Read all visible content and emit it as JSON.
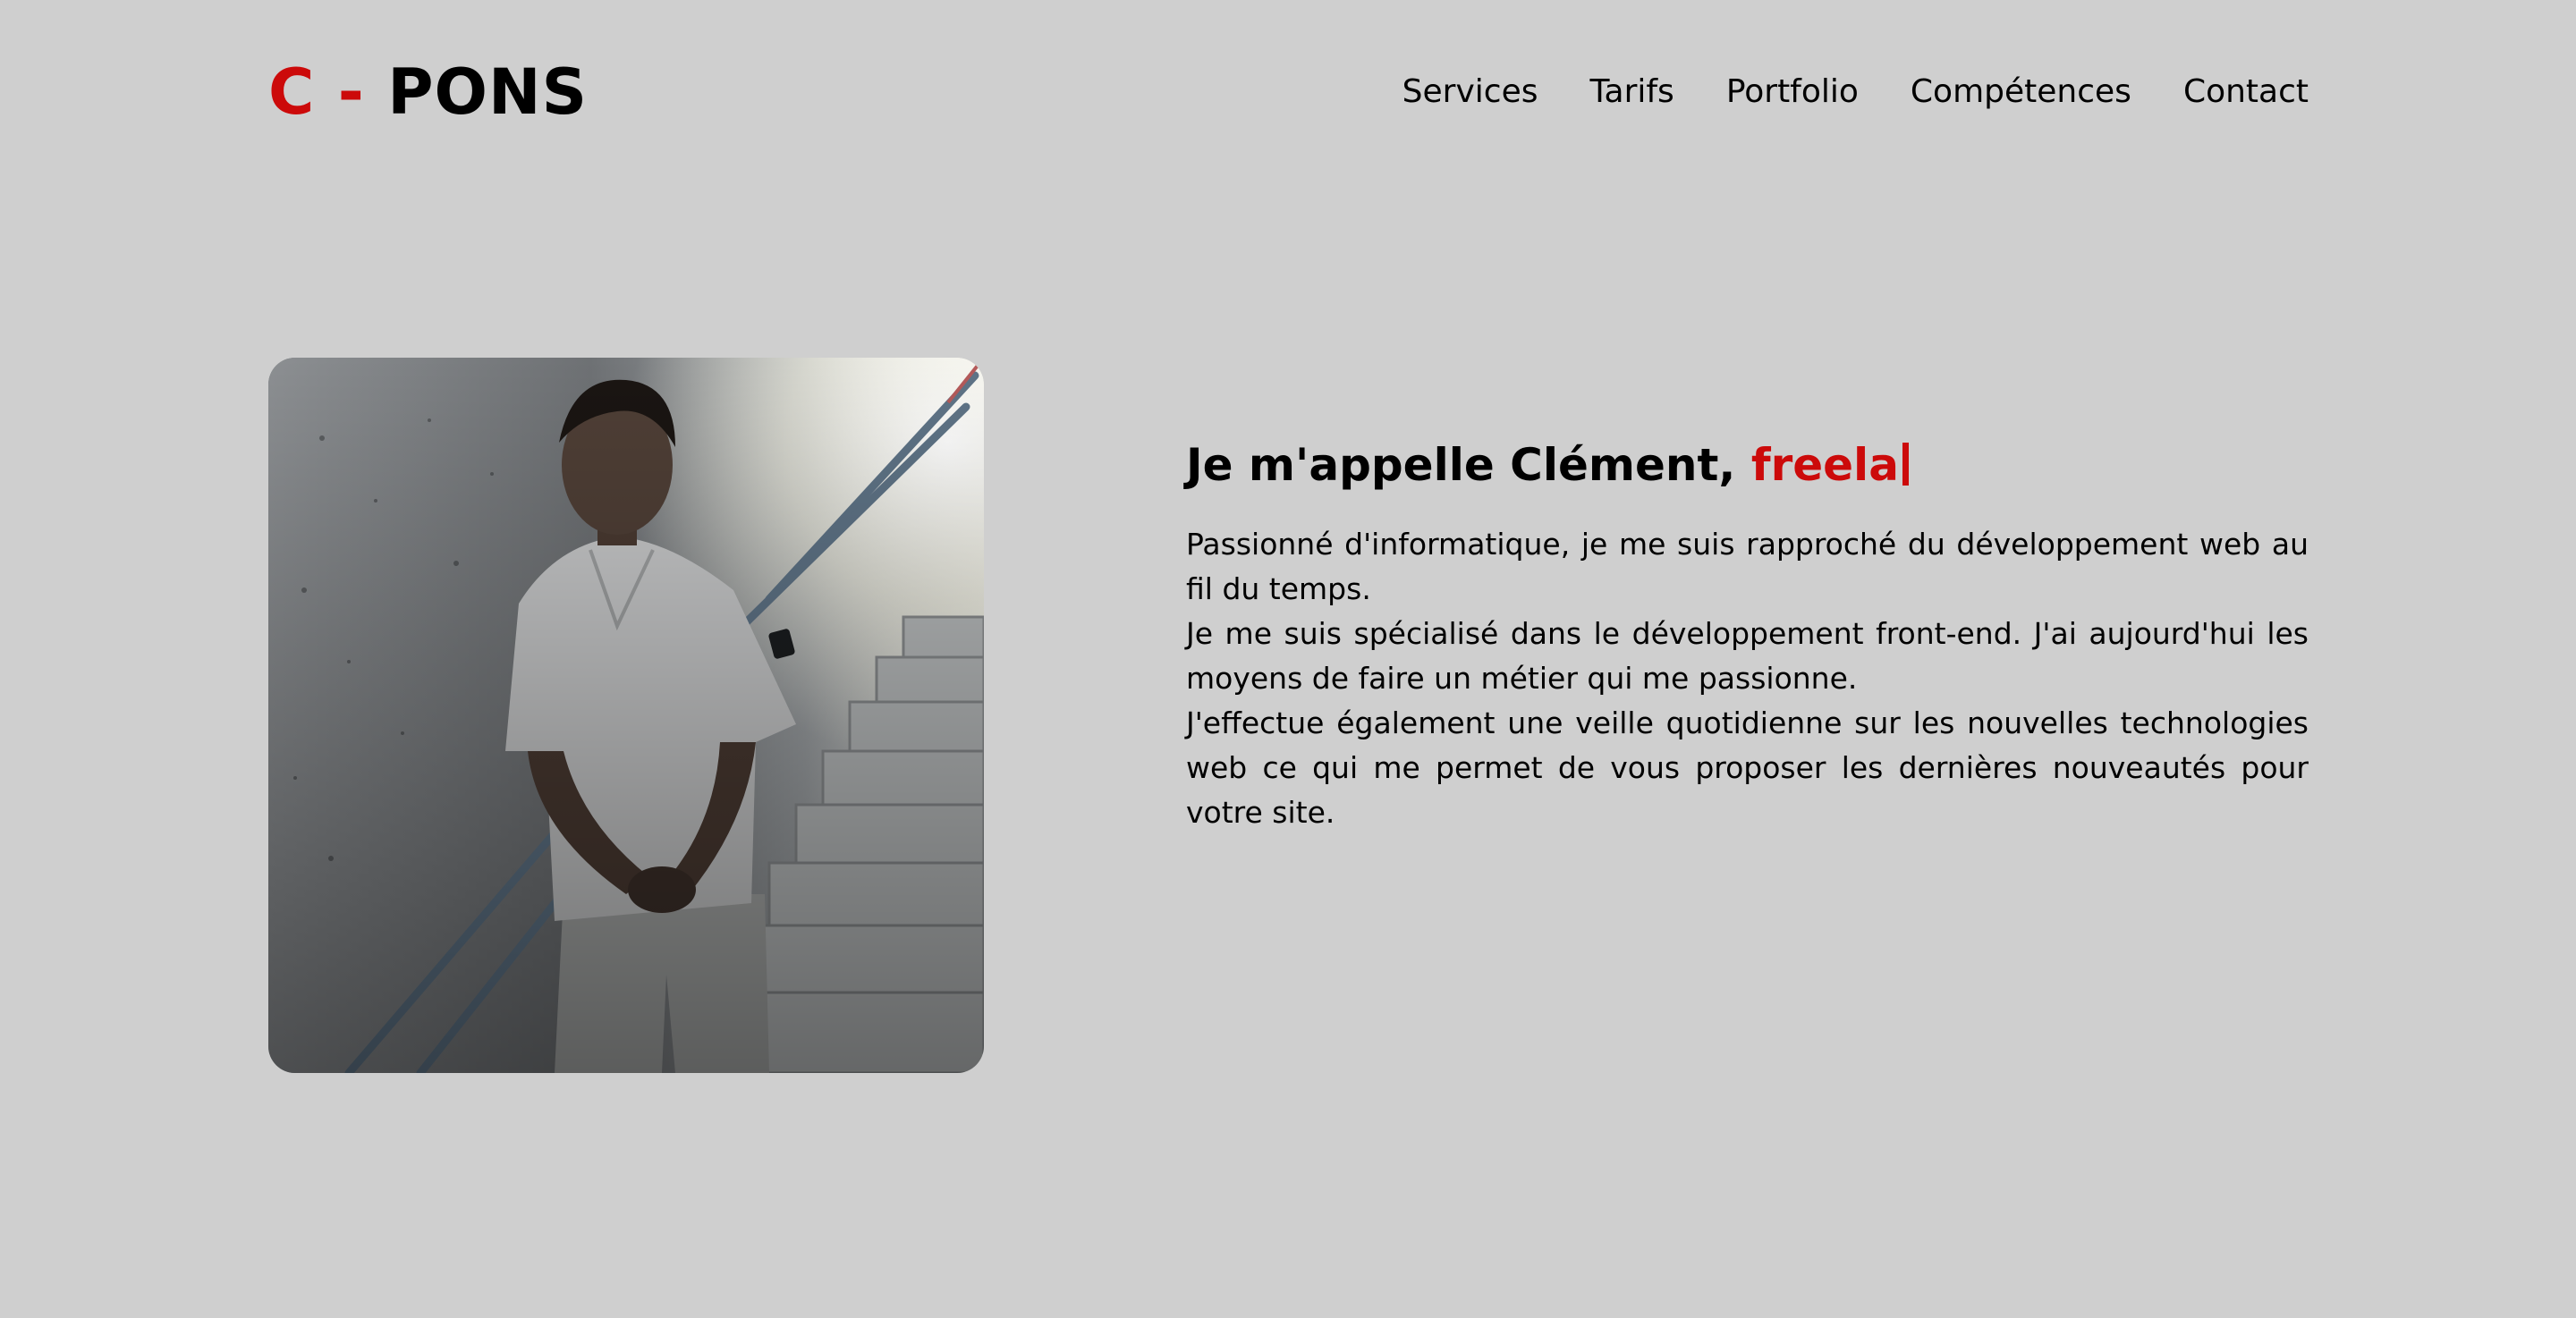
{
  "header": {
    "logo": {
      "initial": "C",
      "separator": "-",
      "name": "PONS"
    },
    "nav": [
      {
        "label": "Services"
      },
      {
        "label": "Tarifs"
      },
      {
        "label": "Portfolio"
      },
      {
        "label": "Compétences"
      },
      {
        "label": "Contact"
      }
    ]
  },
  "hero": {
    "photo_alt": "portrait-photo",
    "heading_prefix": "Je m'appelle Clément,",
    "heading_typed": "freela",
    "paragraphs": [
      "Passionné d'informatique, je me suis rapproché du développement web au fil du temps.",
      "Je me suis spécialisé dans le développement front-end. J'ai aujourd'hui les moyens de faire un métier qui me passionne.",
      "J'effectue également une veille quotidienne sur les nouvelles technologies web ce qui me permet de vous proposer les dernières nouveautés pour votre site."
    ]
  },
  "colors": {
    "background": "#cfcfcf",
    "accent": "#cc0a0a",
    "text": "#000000"
  }
}
